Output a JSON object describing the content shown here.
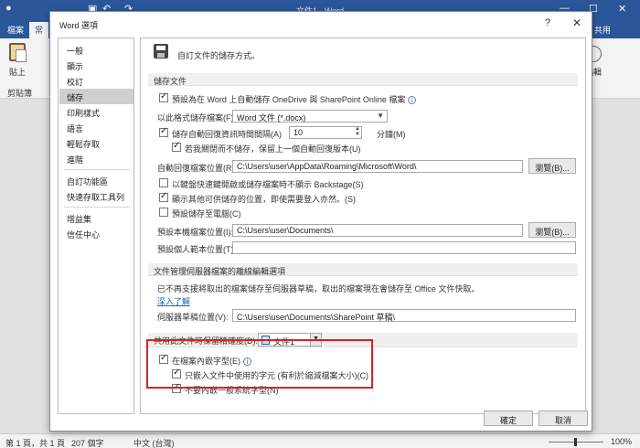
{
  "word": {
    "doc_title": "文件1 - Word",
    "tabs": [
      "檔案",
      "常"
    ],
    "right_tab": "共用",
    "ribbon": {
      "paste_label": "貼上",
      "clipboard_group": "剪貼簿",
      "right_label": "編輯"
    },
    "status": {
      "page": "第 1 頁，共 1 頁",
      "words": "207 個字",
      "language": "中文 (台灣)",
      "zoom": "100%"
    }
  },
  "dialog": {
    "title": "Word 選項",
    "help": "?",
    "close": "✕",
    "nav": [
      "一般",
      "顯示",
      "校訂",
      "儲存",
      "印刷樣式",
      "語言",
      "輕鬆存取",
      "進階",
      "自訂功能區",
      "快速存取工具列",
      "增益集",
      "信任中心"
    ],
    "selected_nav": "儲存",
    "intro": "自訂文件的儲存方式。",
    "save_section": {
      "header": "儲存文件",
      "default_onedrive": "預設為在 Word 上自動儲存 OneDrive 與 SharePoint Online 檔案",
      "format_label": "以此格式儲存檔案(F):",
      "format_value": "Word 文件 (*.docx)",
      "autorecover_label": "儲存自動回復資訊時間間隔(A)",
      "autorecover_minutes": "10",
      "minutes_unit": "分鐘(M)",
      "keep_last_version": "若我關閉而不儲存，保留上一個自動回復版本(U)",
      "autorecover_location_label": "自動回復檔案位置(R):",
      "autorecover_location": "C:\\Users\\user\\AppData\\Roaming\\Microsoft\\Word\\",
      "browse": "瀏覽(B)...",
      "no_backstage": "以鍵盤快速鍵開啟或儲存檔案時不顯示 Backstage(S)",
      "show_additional": "顯示其他可供儲存的位置，即使需要登入亦然。(S)",
      "save_to_computer": "預設儲存至電腦(C)",
      "default_local_label": "預設本機檔案位置(I):",
      "default_local": "C:\\Users\\user\\Documents\\",
      "template_location_label": "預設個人範本位置(T):",
      "template_location": ""
    },
    "offline_section": {
      "header": "文件管理伺服器檔案的離線編輯選項",
      "notice": "已不再支援將取出的檔案儲存至伺服器草稿，取出的檔案現在會儲存至 Office 文件快取。",
      "learn_more": "深入了解",
      "drafts_label": "伺服器草稿位置(V):",
      "drafts_location": "C:\\Users\\user\\Documents\\SharePoint 草稿\\"
    },
    "fidelity_section": {
      "header_label": "共用此文件時保留精確度(D):",
      "document": "文件1",
      "embed_fonts": "在檔案內嵌字型(E)",
      "embed_only_used": "只嵌入文件中使用的字元 (有利於縮減檔案大小)(C)",
      "no_common_fonts": "不要內嵌一般系統字型(N)"
    },
    "ok": "確定",
    "cancel": "取消"
  }
}
